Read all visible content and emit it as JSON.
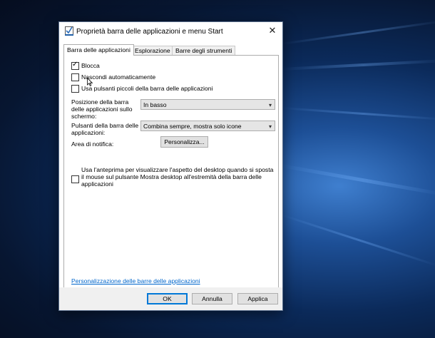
{
  "dialog": {
    "title": "Proprietà barra delle applicazioni e menu Start",
    "close_glyph": "✕"
  },
  "tabs": [
    {
      "label": "Barra delle applicazioni",
      "active": true
    },
    {
      "label": "Esplorazione",
      "active": false
    },
    {
      "label": "Barre degli strumenti",
      "active": false
    }
  ],
  "options": {
    "lock": {
      "label": "Blocca",
      "checked": true
    },
    "autohide": {
      "label": "Nascondi automaticamente",
      "checked": false
    },
    "small_buttons": {
      "label": "Usa pulsanti piccoli della barra delle applicazioni",
      "checked": false
    }
  },
  "position": {
    "label": "Posizione della barra delle applicazioni sullo schermo:",
    "value": "In basso"
  },
  "buttons_combine": {
    "label": "Pulsanti della barra delle applicazioni:",
    "value": "Combina sempre, mostra solo icone"
  },
  "notification": {
    "label": "Area di notifica:",
    "button": "Personalizza..."
  },
  "peek": {
    "label": "Usa l'anteprima per visualizzare l'aspetto del desktop quando si sposta il mouse sul pulsante Mostra desktop all'estremità della barra delle applicazioni",
    "checked": false
  },
  "help_link": "Personalizzazione delle barre delle applicazioni",
  "footer": {
    "ok": "OK",
    "cancel": "Annulla",
    "apply": "Applica"
  },
  "icons": {
    "title": "taskbar-properties-icon",
    "dropdown": "chevron-down-icon",
    "check": "checkmark-icon"
  },
  "colors": {
    "accent": "#0078d7",
    "link": "#0066cc"
  }
}
